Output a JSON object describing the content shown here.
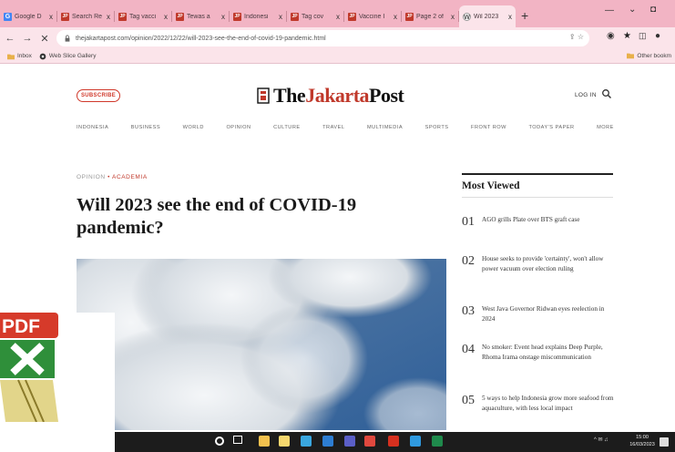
{
  "browser": {
    "tabs": [
      {
        "title": "Google D",
        "favicon": "google-icon"
      },
      {
        "title": "Search Re",
        "favicon": "jp-icon"
      },
      {
        "title": "Tag vacci",
        "favicon": "jp-icon"
      },
      {
        "title": "Tewas a",
        "favicon": "jp-icon"
      },
      {
        "title": "Indonesi",
        "favicon": "jp-icon"
      },
      {
        "title": "Tag cov",
        "favicon": "jp-icon"
      },
      {
        "title": "Vaccine I",
        "favicon": "jp-icon"
      },
      {
        "title": "Page 2 of",
        "favicon": "jp-icon"
      },
      {
        "title": "Wil 2023",
        "favicon": "wiki-icon",
        "active": true
      }
    ],
    "close_glyph": "x",
    "new_tab_glyph": "+",
    "url": "thejakartapost.com/opinion/2022/12/22/will-2023-see-the-end-of-covid-19-pandemic.html",
    "bookmarks": [
      {
        "label": "Inbox",
        "icon": "folder-icon"
      },
      {
        "label": "Web Slice Gallery",
        "icon": "globe-icon"
      }
    ],
    "other_bookmarks": "Other bookm"
  },
  "site": {
    "subscribe": "SUBSCRIBE",
    "logo_the": "The",
    "logo_jakarta": "Jakarta",
    "logo_post": "Post",
    "login": "LOG IN",
    "nav": [
      "INDONESIA",
      "BUSINESS",
      "WORLD",
      "OPINION",
      "CULTURE",
      "TRAVEL",
      "MULTIMEDIA",
      "SPORTS",
      "FRONT ROW",
      "TODAY'S PAPER",
      "MORE"
    ]
  },
  "article": {
    "section": "OPINION",
    "separator": "•",
    "subsection": "ACADEMIA",
    "headline": "Will 2023 see the end of COVID-19 pandemic?"
  },
  "most_viewed": {
    "title": "Most Viewed",
    "items": [
      {
        "num": "01",
        "text": "AGO grills Plate over BTS graft case"
      },
      {
        "num": "02",
        "text": "House seeks to provide 'certainty', won't allow power vacuum over election ruling"
      },
      {
        "num": "03",
        "text": "West Java Governor Ridwan eyes reelection in 2024"
      },
      {
        "num": "04",
        "text": "No smoker: Event head explains Deep Purple, Rhoma Irama onstage miscommunication"
      },
      {
        "num": "05",
        "text": "5 ways to help Indonesia grow more seafood from aquaculture, with less local impact"
      }
    ]
  },
  "desktop": {
    "file_icon_label": "PDF"
  },
  "taskbar": {
    "tray_text": "^ ✉ ♫",
    "time": "15:00",
    "date": "16/03/2023"
  }
}
